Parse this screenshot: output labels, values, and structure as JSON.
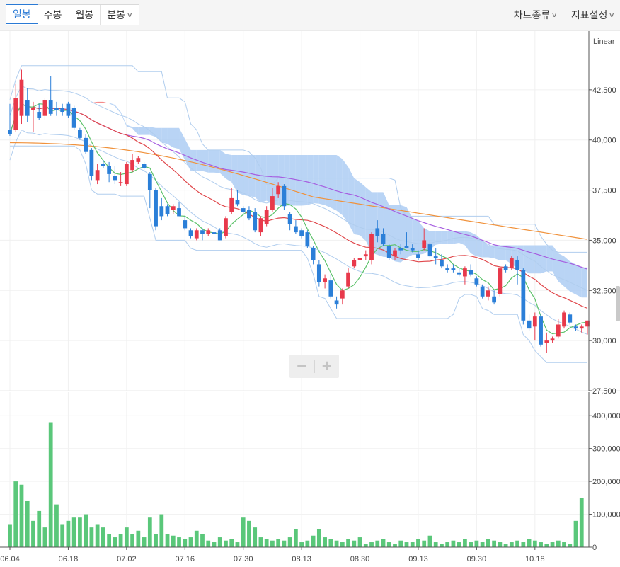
{
  "toolbar": {
    "tabs": [
      {
        "label": "일봉",
        "active": true
      },
      {
        "label": "주봉",
        "active": false
      },
      {
        "label": "월봉",
        "active": false
      },
      {
        "label": "분봉",
        "active": false,
        "dropdown": true
      }
    ],
    "menus": [
      {
        "label": "차트종류"
      },
      {
        "label": "지표설정"
      }
    ]
  },
  "zoom": {
    "minus": "−",
    "plus": "+"
  },
  "chart_data": {
    "type": "candlestick",
    "scale_label": "Linear",
    "price_axis": {
      "ticks": [
        "42,500",
        "40,000",
        "37,500",
        "35,000",
        "32,500",
        "30,000",
        "27,500"
      ],
      "values": [
        42500,
        40000,
        37500,
        35000,
        32500,
        30000,
        27500
      ],
      "range": [
        27500,
        45000
      ]
    },
    "volume_axis": {
      "ticks": [
        "400,000",
        "300,000",
        "200,000",
        "100,000",
        "0"
      ],
      "values": [
        400000,
        300000,
        200000,
        100000,
        0
      ],
      "range": [
        0,
        450000
      ]
    },
    "x_ticks": [
      {
        "label": "06.04",
        "index": 0
      },
      {
        "label": "06.18",
        "index": 10
      },
      {
        "label": "07.02",
        "index": 20
      },
      {
        "label": "07.16",
        "index": 30
      },
      {
        "label": "07.30",
        "index": 40
      },
      {
        "label": "08.13",
        "index": 50
      },
      {
        "label": "08.30",
        "index": 60
      },
      {
        "label": "09.13",
        "index": 70
      },
      {
        "label": "09.30",
        "index": 80
      },
      {
        "label": "10.18",
        "index": 90
      }
    ],
    "colors": {
      "up": "#e8394b",
      "down": "#2b7fd8",
      "volume": "#5ac77a",
      "ma5": "#5cc26a",
      "ma20": "#e0484c",
      "ma60": "#a65de0",
      "ma120": "#f0923c",
      "cloud_up": "#f26b6b",
      "cloud_down": "#a8c9f2",
      "band": "#b0cdee"
    },
    "candles": [
      [
        40500,
        41800,
        40200,
        40300
      ],
      [
        40500,
        42800,
        40400,
        42100
      ],
      [
        41200,
        43500,
        40800,
        43000
      ],
      [
        42000,
        42600,
        40900,
        41200
      ],
      [
        41500,
        41900,
        40400,
        41600
      ],
      [
        41400,
        41800,
        41000,
        41100
      ],
      [
        41200,
        42100,
        41000,
        42000
      ],
      [
        42000,
        43200,
        41200,
        41300
      ],
      [
        41600,
        41900,
        41200,
        41500
      ],
      [
        41600,
        41800,
        41200,
        41400
      ],
      [
        41800,
        41900,
        41100,
        41200
      ],
      [
        41600,
        41700,
        40500,
        40600
      ],
      [
        40500,
        40600,
        40000,
        40100
      ],
      [
        40100,
        40300,
        39300,
        39400
      ],
      [
        39500,
        39600,
        38000,
        38200
      ],
      [
        38000,
        38800,
        37800,
        38500
      ],
      [
        38800,
        39000,
        38600,
        38700
      ],
      [
        38700,
        38900,
        37900,
        38300
      ],
      [
        38200,
        38700,
        37800,
        38000
      ],
      [
        37900,
        38400,
        37700,
        37900
      ],
      [
        37800,
        38900,
        37700,
        38800
      ],
      [
        38500,
        39300,
        38400,
        39000
      ],
      [
        38900,
        39200,
        38800,
        39100
      ],
      [
        38800,
        38900,
        38400,
        38600
      ],
      [
        38300,
        38400,
        36600,
        37500
      ],
      [
        37500,
        37600,
        35500,
        35700
      ],
      [
        36700,
        37100,
        36000,
        36200
      ],
      [
        36700,
        36800,
        36200,
        36300
      ],
      [
        36500,
        36800,
        36300,
        36700
      ],
      [
        36600,
        36900,
        36200,
        36200
      ],
      [
        36000,
        36200,
        35500,
        35600
      ],
      [
        35500,
        35600,
        35100,
        35200
      ],
      [
        35100,
        35600,
        35000,
        35500
      ],
      [
        35500,
        35600,
        35000,
        35300
      ],
      [
        35300,
        35600,
        35200,
        35500
      ],
      [
        35400,
        35600,
        35200,
        35300
      ],
      [
        35500,
        35600,
        35000,
        35000
      ],
      [
        35200,
        36200,
        35100,
        36100
      ],
      [
        36400,
        37600,
        36300,
        37100
      ],
      [
        37000,
        37500,
        36700,
        36800
      ],
      [
        36600,
        36700,
        36300,
        36400
      ],
      [
        36500,
        36700,
        36000,
        36100
      ],
      [
        36400,
        36600,
        35400,
        35500
      ],
      [
        35400,
        36200,
        35200,
        36100
      ],
      [
        35800,
        36700,
        35700,
        36500
      ],
      [
        36500,
        37600,
        36400,
        37200
      ],
      [
        37300,
        37900,
        37100,
        37700
      ],
      [
        37700,
        37800,
        36500,
        36700
      ],
      [
        36300,
        36400,
        35500,
        35800
      ],
      [
        35700,
        36000,
        35300,
        35400
      ],
      [
        35500,
        35600,
        35100,
        35200
      ],
      [
        35400,
        35500,
        34600,
        34700
      ],
      [
        34600,
        34700,
        33800,
        34000
      ],
      [
        33800,
        34000,
        32700,
        32900
      ],
      [
        32900,
        33300,
        32600,
        33100
      ],
      [
        33000,
        33300,
        32100,
        32200
      ],
      [
        32000,
        32200,
        31600,
        31800
      ],
      [
        32100,
        32600,
        31800,
        32500
      ],
      [
        32700,
        33600,
        32600,
        33400
      ],
      [
        33700,
        34100,
        33600,
        34000
      ],
      [
        34000,
        34100,
        34000,
        34100
      ],
      [
        34200,
        34500,
        34000,
        34300
      ],
      [
        34000,
        35400,
        33800,
        35300
      ],
      [
        35600,
        36000,
        34900,
        35200
      ],
      [
        35300,
        35600,
        34700,
        34800
      ],
      [
        34700,
        34800,
        34000,
        34100
      ],
      [
        34200,
        34600,
        34000,
        34500
      ],
      [
        34600,
        34800,
        34300,
        34500
      ],
      [
        34700,
        35400,
        34600,
        34600
      ],
      [
        34600,
        34800,
        34400,
        34500
      ],
      [
        34300,
        34500,
        34000,
        34100
      ],
      [
        34600,
        35600,
        34500,
        35000
      ],
      [
        34800,
        35000,
        34100,
        34200
      ],
      [
        34200,
        34600,
        33800,
        34100
      ],
      [
        34000,
        34300,
        33600,
        33700
      ],
      [
        33600,
        33800,
        33400,
        33500
      ],
      [
        33600,
        33800,
        33400,
        33500
      ],
      [
        33400,
        33600,
        33200,
        33300
      ],
      [
        33200,
        33700,
        32800,
        33600
      ],
      [
        33500,
        33800,
        33200,
        33300
      ],
      [
        33100,
        33200,
        32700,
        32800
      ],
      [
        32700,
        32800,
        32100,
        32200
      ],
      [
        32200,
        32700,
        32000,
        32500
      ],
      [
        32200,
        32500,
        31800,
        31900
      ],
      [
        32300,
        33600,
        32200,
        33600
      ],
      [
        33700,
        33800,
        33400,
        33500
      ],
      [
        33600,
        34200,
        33500,
        34100
      ],
      [
        34000,
        34200,
        32800,
        33500
      ],
      [
        33500,
        33600,
        30800,
        31000
      ],
      [
        31000,
        31300,
        30500,
        30600
      ],
      [
        30700,
        31400,
        30000,
        31200
      ],
      [
        31200,
        31300,
        29700,
        29800
      ],
      [
        29900,
        30400,
        29400,
        30000
      ],
      [
        30000,
        30200,
        29900,
        30100
      ],
      [
        30200,
        31100,
        30100,
        30800
      ],
      [
        30700,
        31500,
        30600,
        31400
      ],
      [
        31300,
        31400,
        30800,
        30900
      ],
      [
        30700,
        30800,
        30500,
        30600
      ],
      [
        30600,
        30800,
        30400,
        30700
      ],
      [
        30700,
        31000,
        30300,
        31000
      ]
    ],
    "volume": [
      70000,
      200000,
      190000,
      140000,
      80000,
      110000,
      60000,
      380000,
      130000,
      70000,
      80000,
      90000,
      90000,
      100000,
      60000,
      70000,
      60000,
      40000,
      30000,
      40000,
      60000,
      40000,
      50000,
      30000,
      90000,
      40000,
      100000,
      40000,
      35000,
      30000,
      25000,
      30000,
      50000,
      40000,
      20000,
      15000,
      30000,
      20000,
      25000,
      15000,
      90000,
      80000,
      60000,
      30000,
      25000,
      20000,
      25000,
      20000,
      30000,
      55000,
      15000,
      20000,
      35000,
      55000,
      30000,
      25000,
      20000,
      15000,
      25000,
      20000,
      30000,
      10000,
      15000,
      20000,
      25000,
      15000,
      10000,
      20000,
      15000,
      15000,
      25000,
      20000,
      35000,
      15000,
      10000,
      15000,
      20000,
      15000,
      25000,
      15000,
      20000,
      15000,
      25000,
      20000,
      15000,
      10000,
      15000,
      20000,
      15000,
      25000,
      20000,
      15000,
      10000,
      15000,
      20000,
      15000,
      10000,
      80000,
      150000
    ]
  }
}
